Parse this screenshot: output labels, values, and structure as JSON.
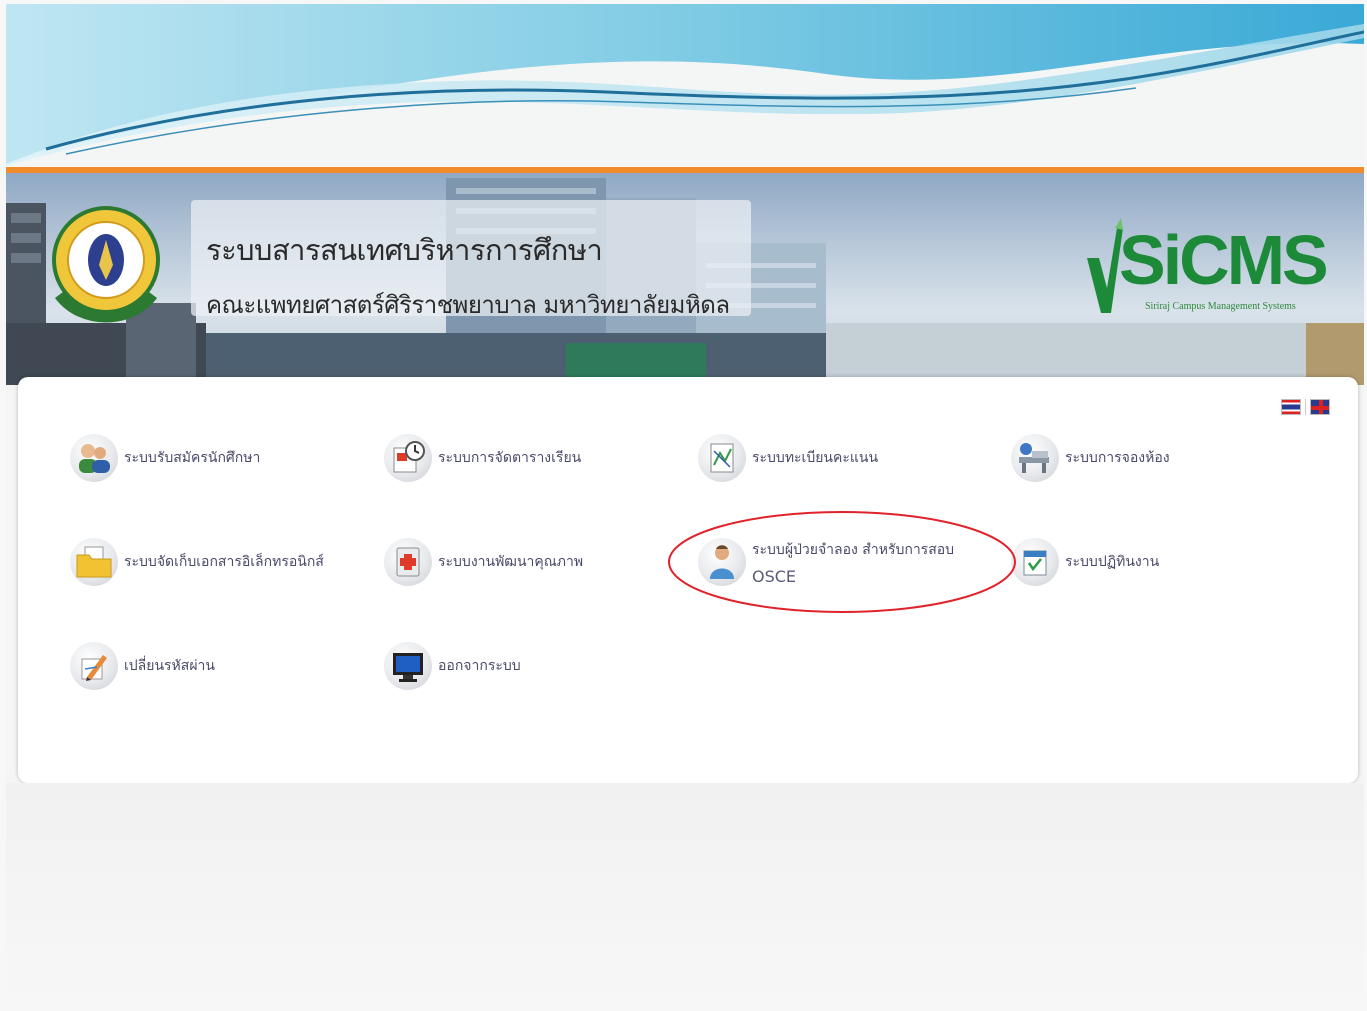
{
  "banner": {
    "title_line1": "ระบบสารสนเทศบริหารการศึกษา",
    "title_line2": "คณะแพทยศาสตร์ศิริราชพยาบาล มหาวิทยาลัยมหิดล",
    "brand_name": "SiCMS",
    "brand_tagline": "Siriraj Campus Management Systems",
    "brand_color": "#1d8a3a",
    "accent_color": "#f08a2a"
  },
  "language": {
    "thai_flag": "flag-th-icon",
    "english_flag": "flag-uk-icon"
  },
  "menu": [
    {
      "label": "ระบบรับสมัครนักศึกษา",
      "icon": "users-icon"
    },
    {
      "label": "ระบบการจัดตารางเรียน",
      "icon": "schedule-icon"
    },
    {
      "label": "ระบบทะเบียนคะแนน",
      "icon": "grade-chart-icon"
    },
    {
      "label": "ระบบการจองห้อง",
      "icon": "room-booking-icon"
    },
    {
      "label": "ระบบจัดเก็บเอกสารอิเล็กทรอนิกส์",
      "icon": "folder-icon"
    },
    {
      "label": "ระบบงานพัฒนาคุณภาพ",
      "icon": "medical-kit-icon"
    },
    {
      "label": "ระบบผู้ป่วยจำลอง สำหรับการสอบ",
      "label_line2": "OSCE",
      "icon": "patient-icon"
    },
    {
      "label": "ระบบปฏิทินงาน",
      "icon": "calendar-icon"
    },
    {
      "label": "เปลี่ยนรหัสผ่าน",
      "icon": "pencil-icon"
    },
    {
      "label": "ออกจากระบบ",
      "icon": "monitor-icon"
    }
  ]
}
